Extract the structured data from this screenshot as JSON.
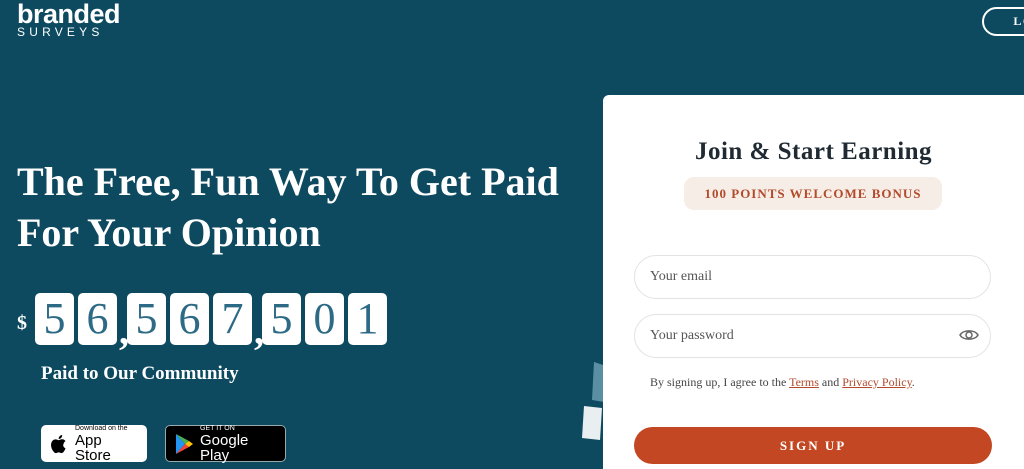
{
  "brand": {
    "line1": "branded",
    "line2": "SURVEYS"
  },
  "header": {
    "login_label": "LOG"
  },
  "hero": {
    "title": "The Free, Fun Way To Get Paid For Your Opinion",
    "currency": "$",
    "digits": [
      "5",
      "6",
      ",",
      "5",
      "6",
      "7",
      ",",
      "5",
      "0",
      "1"
    ],
    "caption": "Paid to Our Community"
  },
  "stores": {
    "appstore": {
      "small": "Download on the",
      "big": "App Store"
    },
    "googleplay": {
      "small": "GET IT ON",
      "big": "Google Play"
    }
  },
  "signup": {
    "title": "Join & Start Earning",
    "bonus": "100 POINTS WELCOME BONUS",
    "email_placeholder": "Your email",
    "password_placeholder": "Your password",
    "terms_prefix": "By signing up, I agree to the ",
    "terms_link": "Terms",
    "terms_and": " and ",
    "privacy_link": "Privacy Policy",
    "terms_suffix": ".",
    "button_label": "SIGN UP"
  },
  "colors": {
    "background": "#0d4a60",
    "accent": "#c24722",
    "bonus_bg": "#f6eee6",
    "digit_text": "#2d6a86"
  },
  "icons": [
    "apple-icon",
    "google-play-icon",
    "eye-icon"
  ]
}
